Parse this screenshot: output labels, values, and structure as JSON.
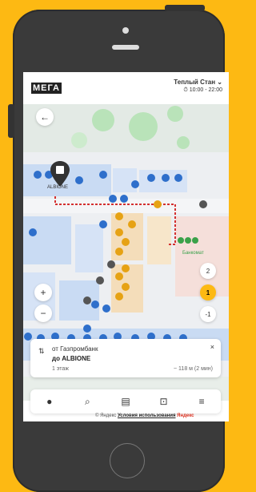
{
  "header": {
    "logo": "МЕГА",
    "store_name": "Теплый Стан",
    "hours": "10:00 - 22:00"
  },
  "map": {
    "destination_label": "ALBIONE",
    "atm_label": "Банкомат",
    "floors": [
      "2",
      "1",
      "-1"
    ],
    "active_floor": "1"
  },
  "route": {
    "from": "от Газпромбанк",
    "to": "до ALBIONE",
    "floor": "1 этаж",
    "distance": "~ 118 м (2 мин)",
    "close": "×"
  },
  "footer": {
    "yandex": "© Яндекс",
    "terms": "Условия использования",
    "brand": "Яндекс"
  },
  "icons": [
    "back-arrow-icon",
    "zoom-in-icon",
    "zoom-out-icon",
    "info-icon",
    "search-icon",
    "map-icon",
    "transport-icon",
    "menu-icon"
  ]
}
